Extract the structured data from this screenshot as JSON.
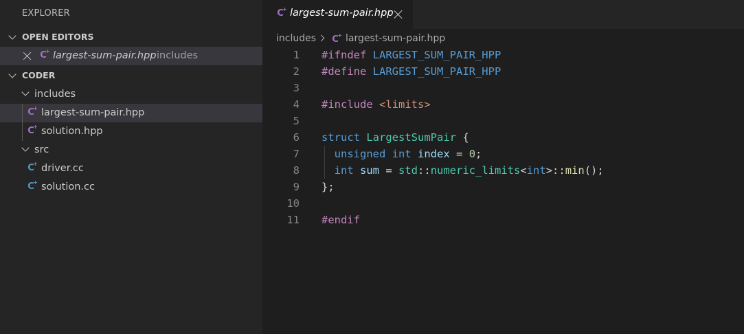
{
  "sidebar": {
    "title": "EXPLORER",
    "open_editors": {
      "header": "OPEN EDITORS",
      "items": [
        {
          "name": "largest-sum-pair.hpp",
          "folder": "includes"
        }
      ]
    },
    "workspace": {
      "header": "CODER",
      "folders": [
        {
          "name": "includes",
          "files": [
            "largest-sum-pair.hpp",
            "solution.hpp"
          ]
        },
        {
          "name": "src",
          "files": [
            "driver.cc",
            "solution.cc"
          ]
        }
      ]
    }
  },
  "tab": {
    "label": "largest-sum-pair.hpp"
  },
  "breadcrumb": {
    "folder": "includes",
    "file": "largest-sum-pair.hpp"
  },
  "editor": {
    "lines": [
      [
        {
          "t": "#ifndef",
          "c": "k-pre"
        },
        {
          "t": " "
        },
        {
          "t": "LARGEST_SUM_PAIR_HPP",
          "c": "k-macro"
        }
      ],
      [
        {
          "t": "#define",
          "c": "k-pre"
        },
        {
          "t": " "
        },
        {
          "t": "LARGEST_SUM_PAIR_HPP",
          "c": "k-macro"
        }
      ],
      [],
      [
        {
          "t": "#include",
          "c": "k-pre"
        },
        {
          "t": " "
        },
        {
          "t": "<limits>",
          "c": "k-str"
        }
      ],
      [],
      [
        {
          "t": "struct",
          "c": "k-type"
        },
        {
          "t": " "
        },
        {
          "t": "LargestSumPair",
          "c": "k-class"
        },
        {
          "t": " {"
        }
      ],
      [
        {
          "t": "  "
        },
        {
          "t": "unsigned",
          "c": "k-type"
        },
        {
          "t": " "
        },
        {
          "t": "int",
          "c": "k-type"
        },
        {
          "t": " "
        },
        {
          "t": "index",
          "c": "k-var"
        },
        {
          "t": " = "
        },
        {
          "t": "0",
          "c": "k-num"
        },
        {
          "t": ";"
        }
      ],
      [
        {
          "t": "  "
        },
        {
          "t": "int",
          "c": "k-type"
        },
        {
          "t": " "
        },
        {
          "t": "sum",
          "c": "k-var"
        },
        {
          "t": " = "
        },
        {
          "t": "std",
          "c": "k-class"
        },
        {
          "t": "::"
        },
        {
          "t": "numeric_limits",
          "c": "k-class"
        },
        {
          "t": "<",
          "c": "k-punct"
        },
        {
          "t": "int",
          "c": "k-type"
        },
        {
          "t": ">::"
        },
        {
          "t": "min",
          "c": "k-fn"
        },
        {
          "t": "();"
        }
      ],
      [
        {
          "t": "};"
        }
      ],
      [],
      [
        {
          "t": "#endif",
          "c": "k-pre"
        }
      ]
    ],
    "line_numbers": [
      "1",
      "2",
      "3",
      "4",
      "5",
      "6",
      "7",
      "8",
      "9",
      "10",
      "11"
    ]
  },
  "colors": {
    "background": "#1e1e1e",
    "sidebar": "#252526",
    "selection": "#37373d",
    "cpp_icon_purple": "#a074c4",
    "cpp_icon_blue": "#519aba"
  },
  "icons": {
    "hpp": "cpp-header-icon",
    "cc": "cpp-source-icon"
  }
}
